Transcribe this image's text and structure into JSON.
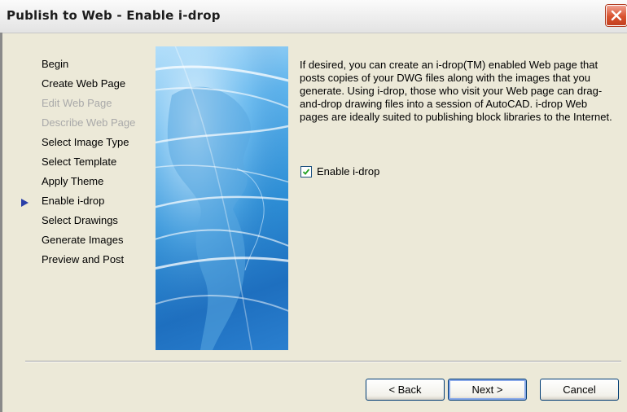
{
  "window": {
    "title": "Publish to Web - Enable i-drop"
  },
  "steps": [
    {
      "label": "Begin",
      "state": "enabled"
    },
    {
      "label": "Create Web Page",
      "state": "enabled"
    },
    {
      "label": "Edit Web Page",
      "state": "disabled"
    },
    {
      "label": "Describe Web Page",
      "state": "disabled"
    },
    {
      "label": "Select Image Type",
      "state": "enabled"
    },
    {
      "label": "Select Template",
      "state": "enabled"
    },
    {
      "label": "Apply Theme",
      "state": "enabled"
    },
    {
      "label": "Enable i-drop",
      "state": "current"
    },
    {
      "label": "Select Drawings",
      "state": "enabled"
    },
    {
      "label": "Generate Images",
      "state": "enabled"
    },
    {
      "label": "Preview and Post",
      "state": "enabled"
    }
  ],
  "description": "If desired, you can create an i-drop(TM) enabled Web page that posts copies of your DWG files along with the images that you generate. Using i-drop, those who visit your Web page can drag-and-drop drawing files into a session of AutoCAD. i-drop Web pages are ideally suited to publishing block libraries to the Internet.",
  "checkbox": {
    "label": "Enable i-drop",
    "checked": true
  },
  "buttons": {
    "back": "< Back",
    "next": "Next >",
    "cancel": "Cancel"
  },
  "icons": {
    "close": "close-icon",
    "step_marker": "current-step-arrow-icon",
    "check": "checkmark-icon"
  },
  "colors": {
    "dialog_bg": "#ECE9D8",
    "close_button": "#D9532F",
    "current_step_marker": "#2A3FA8",
    "banner": "#2E8FD6"
  }
}
